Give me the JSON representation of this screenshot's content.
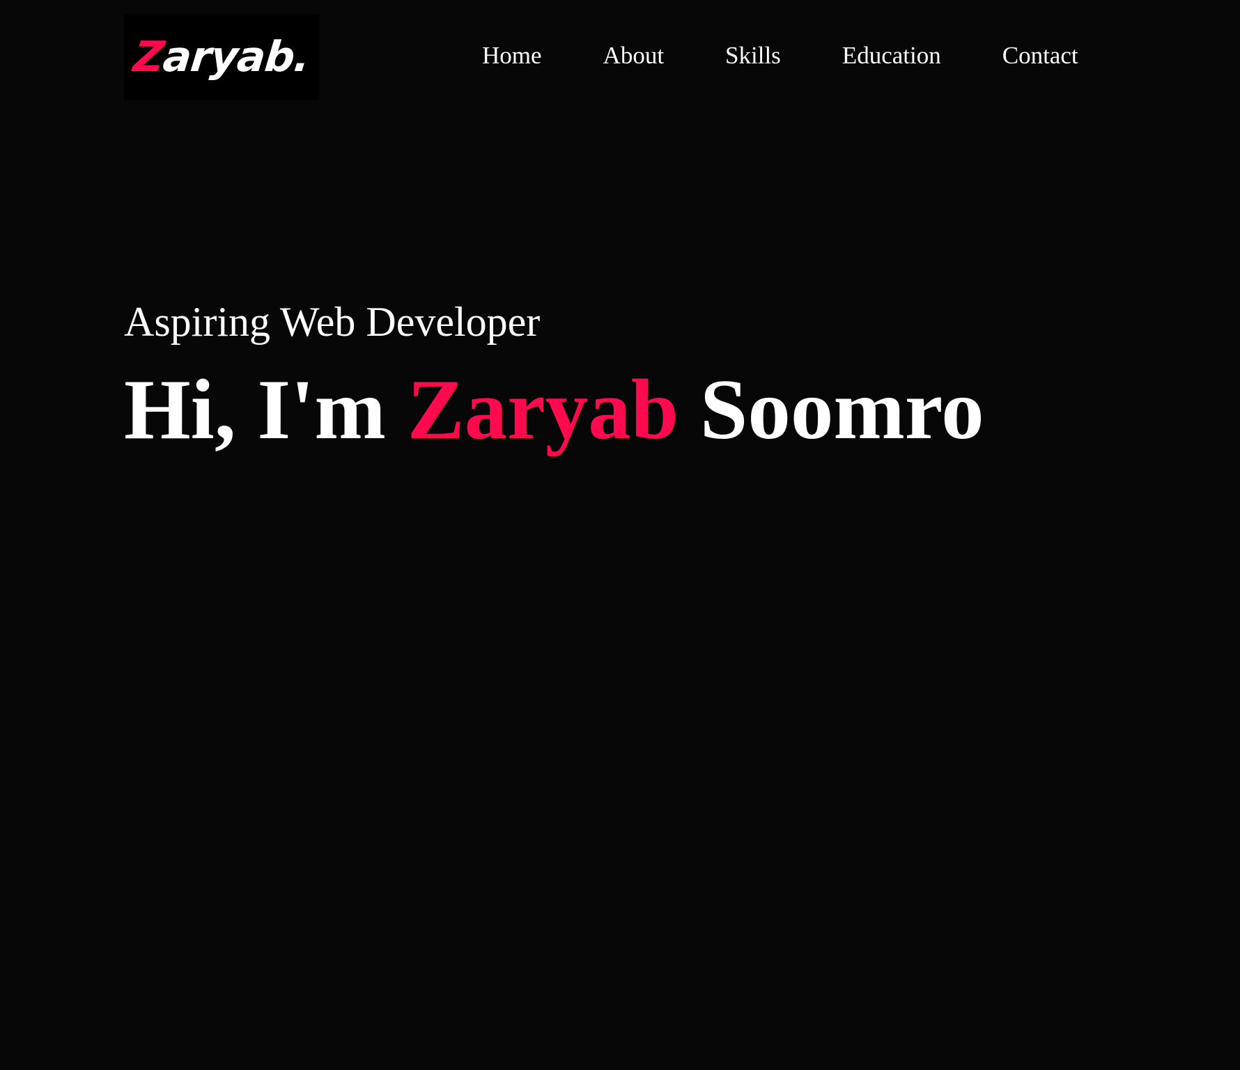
{
  "colors": {
    "background": "#070707",
    "accent": "#ff0a4e",
    "text": "#ffffff"
  },
  "header": {
    "logo": {
      "first_letter": "Z",
      "rest": "aryab."
    },
    "nav": [
      {
        "label": "Home"
      },
      {
        "label": "About"
      },
      {
        "label": "Skills"
      },
      {
        "label": "Education"
      },
      {
        "label": "Contact"
      }
    ]
  },
  "hero": {
    "subtitle": "Aspiring Web Developer",
    "greeting": "Hi, I'm",
    "first_name": "Zaryab",
    "last_name": "Soomro"
  }
}
